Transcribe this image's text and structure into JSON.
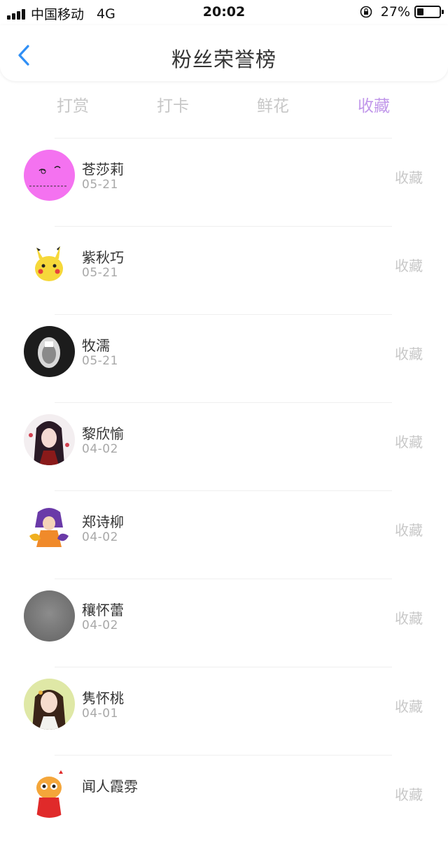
{
  "status_bar": {
    "carrier": "中国移动",
    "network": "4G",
    "time": "20:02",
    "battery": "27%",
    "icons": [
      "signal-icon",
      "rotation-lock-icon",
      "battery-icon"
    ]
  },
  "nav": {
    "back_icon": "chevron-left-icon",
    "title": "粉丝荣誉榜",
    "accent_color": "#2f8ff5"
  },
  "tabs": {
    "items": [
      {
        "label": "打赏"
      },
      {
        "label": "打卡"
      },
      {
        "label": "鲜花"
      },
      {
        "label": "收藏"
      }
    ],
    "active_index": 3,
    "active_color": "#c197ea"
  },
  "list": {
    "items": [
      {
        "name": "苍莎莉",
        "date": "05-21",
        "action": "收藏"
      },
      {
        "name": "紫秋巧",
        "date": "05-21",
        "action": "收藏"
      },
      {
        "name": "牧濡",
        "date": "05-21",
        "action": "收藏"
      },
      {
        "name": "黎欣愉",
        "date": "04-02",
        "action": "收藏"
      },
      {
        "name": "郑诗柳",
        "date": "04-02",
        "action": "收藏"
      },
      {
        "name": "穰怀蕾",
        "date": "04-02",
        "action": "收藏"
      },
      {
        "name": "隽怀桃",
        "date": "04-01",
        "action": "收藏"
      },
      {
        "name": "闻人霞雰",
        "date": "",
        "action": "收藏"
      }
    ]
  }
}
